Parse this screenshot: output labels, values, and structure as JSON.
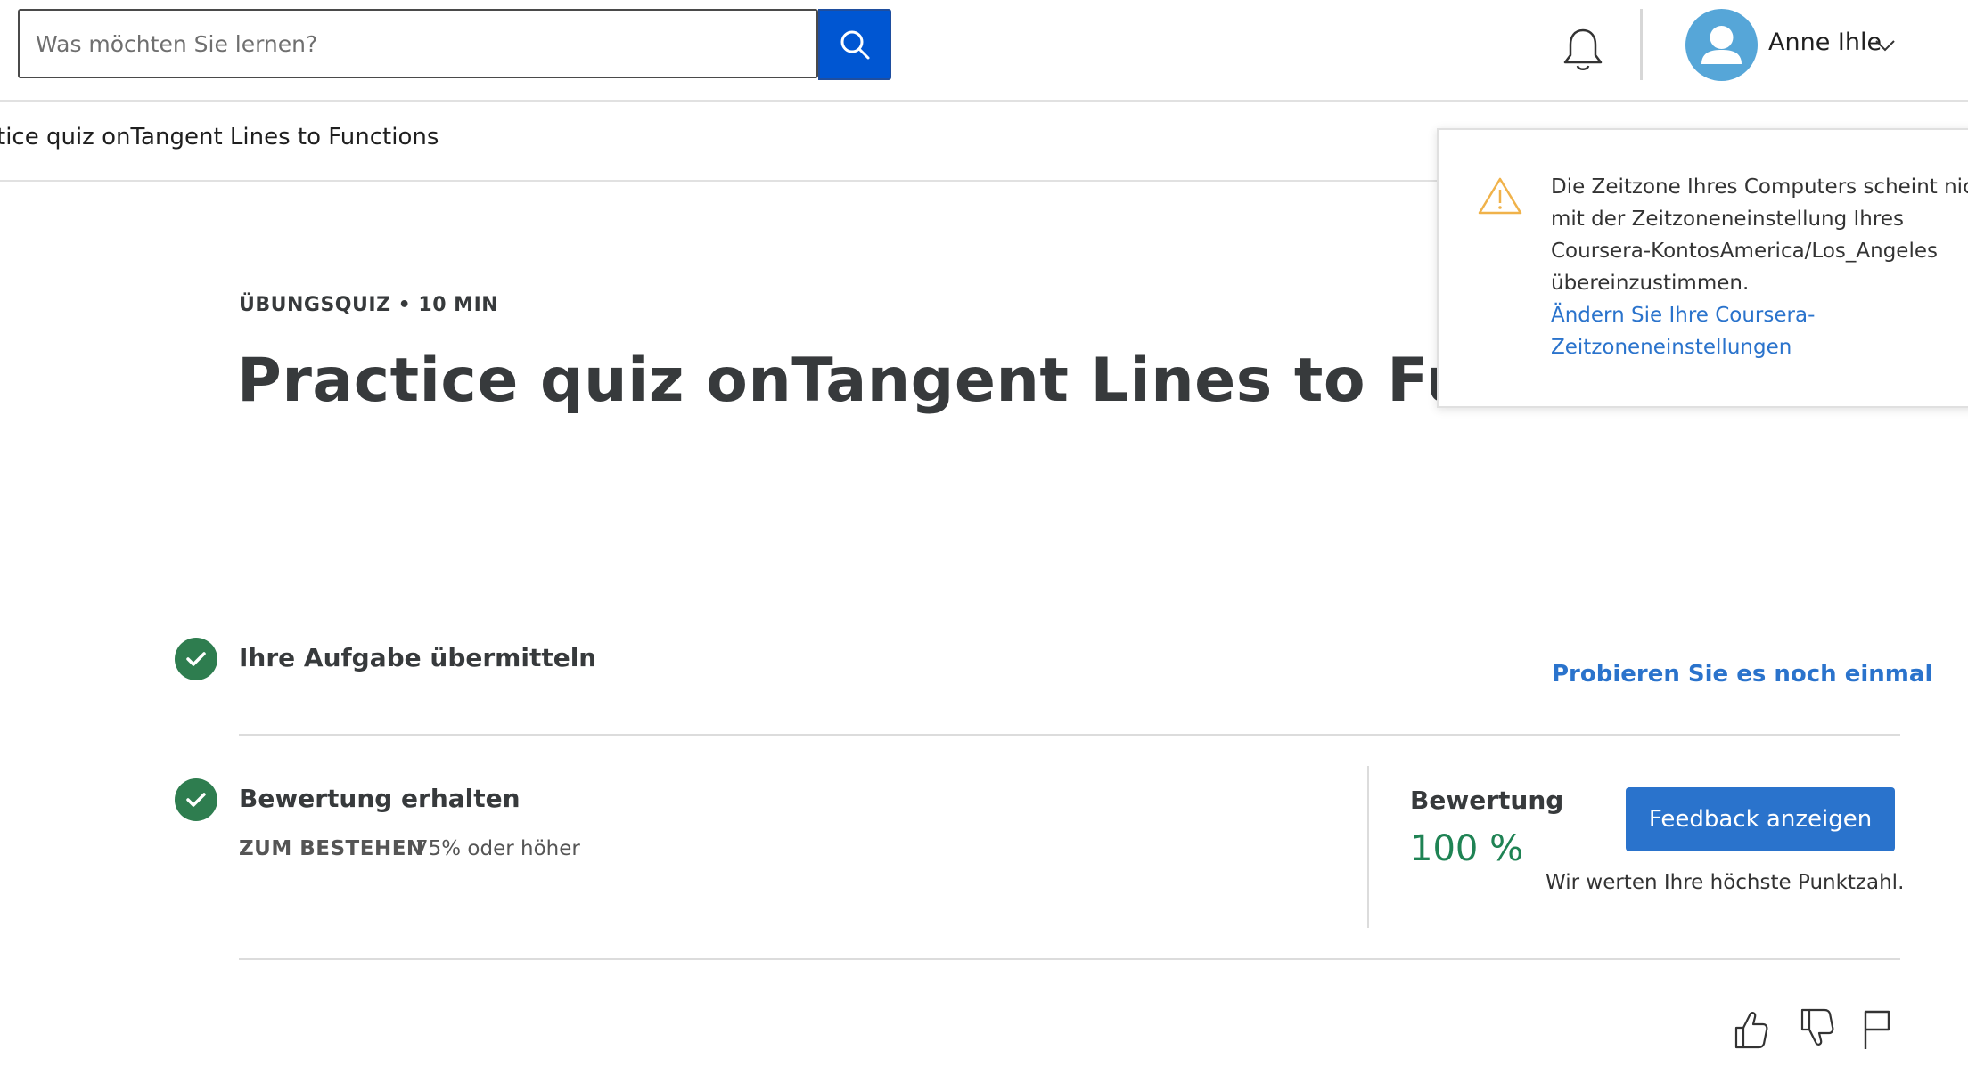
{
  "search": {
    "placeholder": "Was möchten Sie lernen?",
    "button_icon": "search-icon"
  },
  "header": {
    "bell_icon": "bell-icon",
    "user_name": "Anne Ihle",
    "avatar_icon": "user-avatar-icon"
  },
  "breadcrumb": {
    "text": "tice quiz onTangent Lines to Functions"
  },
  "quiz": {
    "eyebrow": "ÜBUNGSQUIZ • 10 MIN",
    "title": "Practice quiz onTangent Lines to Functions"
  },
  "steps": {
    "submit": {
      "title": "Ihre Aufgabe übermitteln",
      "retry_link": "Probieren Sie es noch einmal"
    },
    "grade": {
      "title": "Bewertung erhalten",
      "pass_label": "ZUM BESTEHEN",
      "pass_value": "75% oder höher",
      "grade_label": "Bewertung",
      "grade_value": "100 %",
      "feedback_button": "Feedback anzeigen",
      "note": "Wir werten Ihre höchste Punktzahl."
    }
  },
  "timezone_popover": {
    "message": "Die Zeitzone Ihres Computers scheint nicht mit der Zeitzoneneinstellung Ihres Coursera-KontosAmerica/Los_Angeles übereinzustimmen.",
    "link": "Ändern Sie Ihre Coursera-Zeitzoneneinstellungen"
  },
  "colors": {
    "primary": "#2a73cc",
    "search_blue": "#0056d2",
    "success": "#2e7d4f",
    "grade_green": "#1f8354",
    "warning": "#f0b24a"
  }
}
